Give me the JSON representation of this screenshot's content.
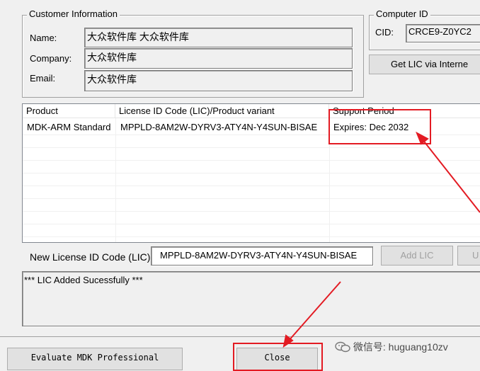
{
  "customer_info": {
    "legend": "Customer Information",
    "name_label": "Name:",
    "name_value": "大众软件库 大众软件库",
    "company_label": "Company:",
    "company_value": "大众软件库",
    "email_label": "Email:",
    "email_value": "大众软件库"
  },
  "computer_id": {
    "legend": "Computer ID",
    "cid_label": "CID:",
    "cid_value": "CRCE9-Z0YC2",
    "get_lic_button": "Get LIC via Interne"
  },
  "license_table": {
    "columns": [
      "Product",
      "License ID Code (LIC)/Product variant",
      "Support Period"
    ],
    "rows": [
      {
        "product": "MDK-ARM Standard",
        "lic": "MPPLD-8AM2W-DYRV3-ATY4N-Y4SUN-BISAE",
        "support": "Expires: Dec 2032"
      }
    ]
  },
  "new_lic": {
    "label": "New License ID Code (LIC):",
    "value": "MPPLD-8AM2W-DYRV3-ATY4N-Y4SUN-BISAE",
    "add_button": "Add LIC",
    "uninstall_button": "U"
  },
  "status_message": "*** LIC Added Sucessfully ***",
  "footer": {
    "evaluate_button": "Evaluate MDK Professional",
    "close_button": "Close"
  },
  "watermark": {
    "text": "微信号: huguang10zv"
  },
  "colors": {
    "annotation_red": "#e31b23",
    "dialog_bg": "#f0f0f0"
  }
}
